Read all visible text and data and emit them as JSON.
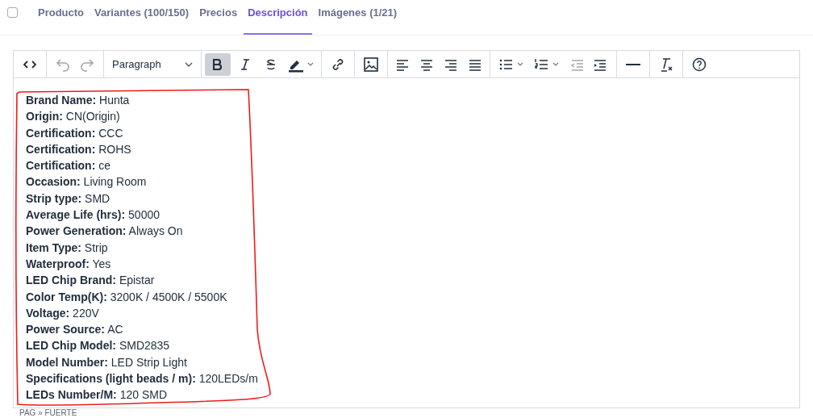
{
  "select_all": {
    "checked": false
  },
  "tabs": [
    {
      "label": "Producto",
      "selected": false
    },
    {
      "label": "Variantes (100/150)",
      "selected": false
    },
    {
      "label": "Precios",
      "selected": false
    },
    {
      "label": "Descripción",
      "selected": true
    },
    {
      "label": "Imágenes (1/21)",
      "selected": false
    }
  ],
  "toolbar": {
    "block_format": "Paragraph",
    "bold_active": true
  },
  "content": [
    "**Brand Name:** Hunta",
    "**Origin:** CN(Origin)",
    "**Certification:** CCC",
    "**Certification:** ROHS",
    "**Certification:** ce",
    "**Occasion:** Living Room",
    "**Strip type:** SMD",
    "**Average Life (hrs):** 50000",
    "**Power Generation:** Always On",
    "**Item Type:** Strip",
    "**Waterproof:** Yes",
    "**LED Chip Brand:** Epistar",
    "**Color Temp(K):** 3200K / 4500K / 5500K",
    "**Voltage:** 220V",
    "**Power Source:** AC",
    "**LED Chip Model:** SMD2835",
    "**Model Number:** LED Strip Light",
    "**Specifications (light beads / m):** 120LEDs/m",
    "**LEDs Number/M:** 120 SMD"
  ],
  "status_bar": "PAG » FUERTE"
}
